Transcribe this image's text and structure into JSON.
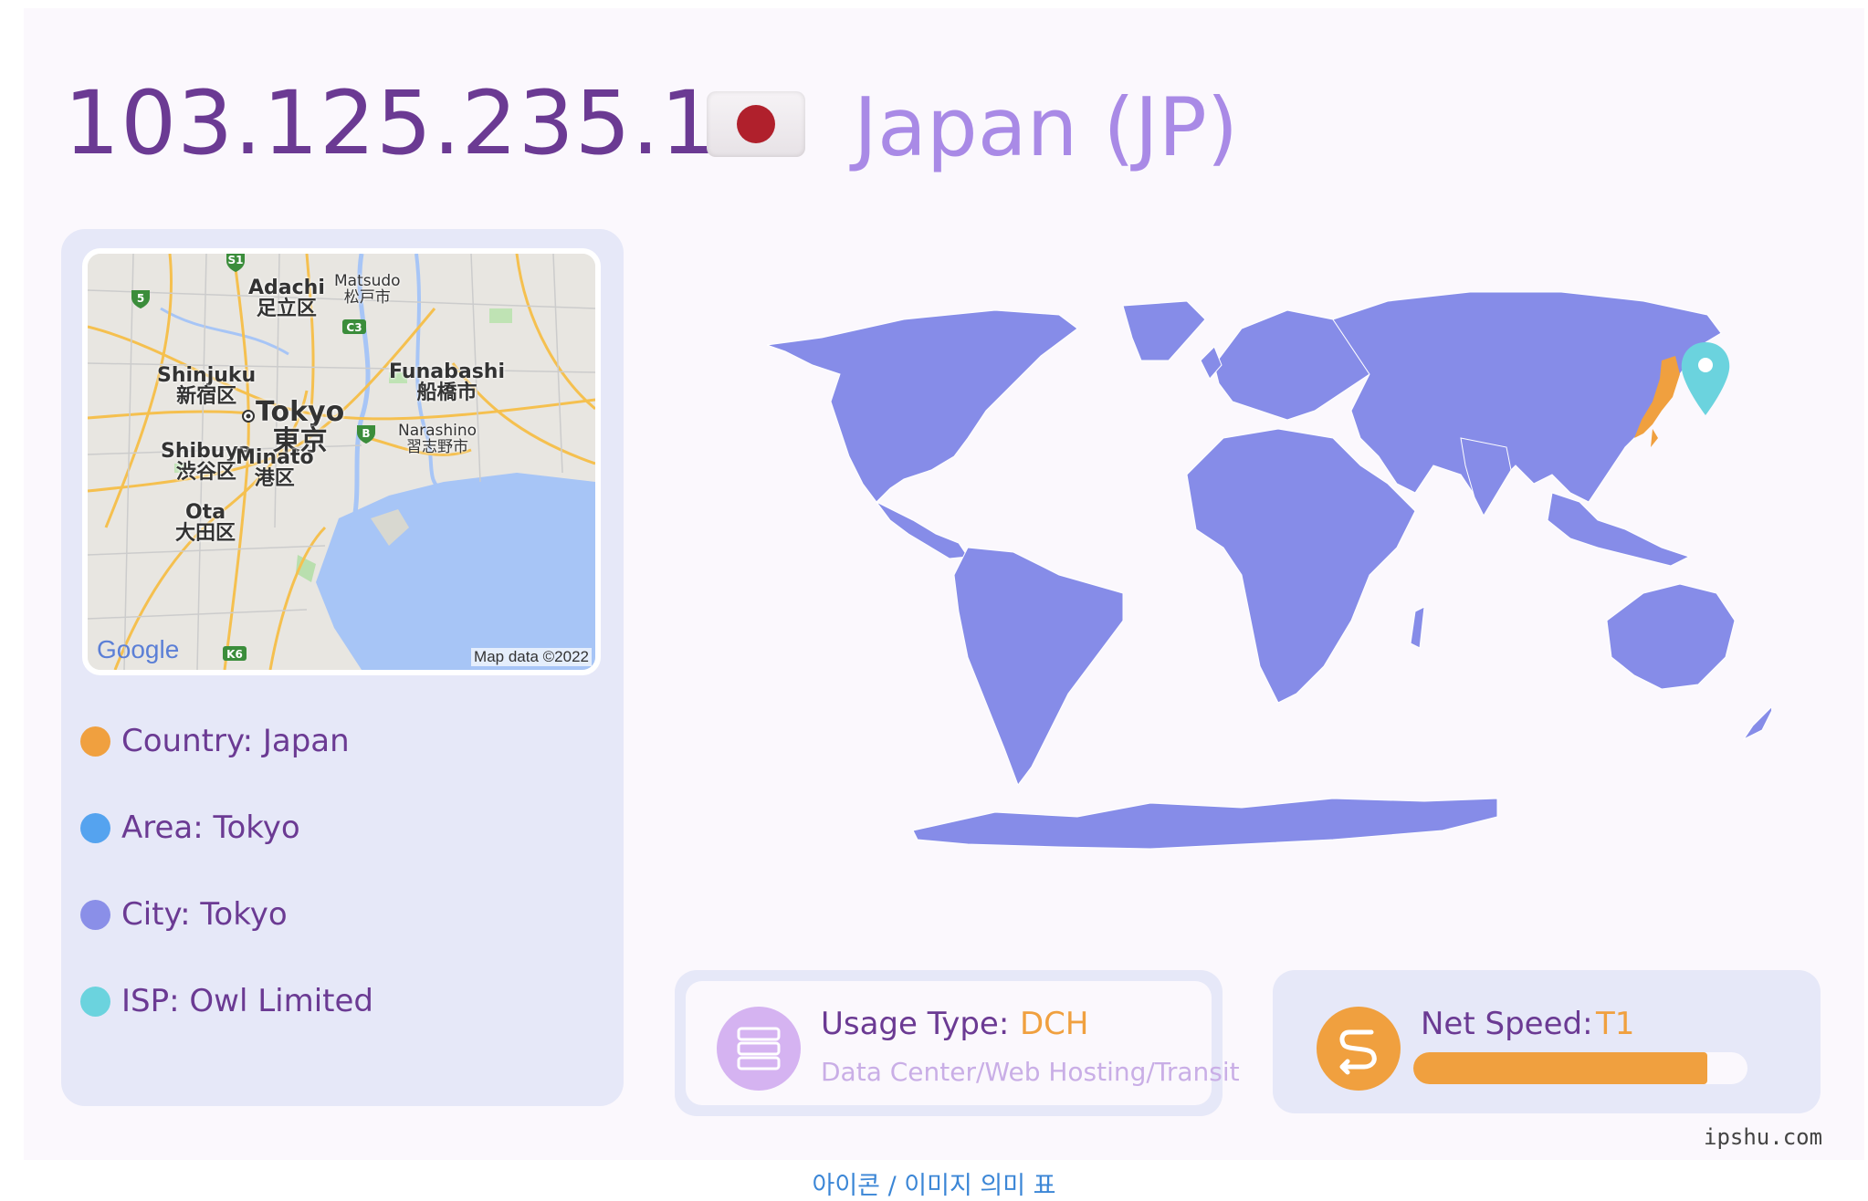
{
  "ip": "103.125.235.1",
  "country_title": "Japan (JP)",
  "map": {
    "labels": {
      "adachi_en": "Adachi",
      "adachi_jp": "足立区",
      "matsudo_en": "Matsudo",
      "matsudo_jp": "松戸市",
      "shinjuku_en": "Shinjuku",
      "shinjuku_jp": "新宿区",
      "tokyo_en": "Tokyo",
      "tokyo_jp": "東京",
      "funabashi_en": "Funabashi",
      "funabashi_jp": "船橋市",
      "narashino_en": "Narashino",
      "narashino_jp": "習志野市",
      "shibuya_en": "Shibuya",
      "shibuya_jp": "渋谷区",
      "minato_en": "Minato",
      "minato_jp": "港区",
      "ota_en": "Ota",
      "ota_jp": "大田区",
      "shield_s1": "S1",
      "shield_5": "5",
      "shield_c3": "C3",
      "shield_b": "B",
      "shield_k6": "K6"
    },
    "google": "Google",
    "attribution": "Map data ©2022"
  },
  "details": [
    {
      "text": "Country: Japan",
      "color": "#f0a03f"
    },
    {
      "text": "Area: Tokyo",
      "color": "#55a3ef"
    },
    {
      "text": "City: Tokyo",
      "color": "#8a8fe8"
    },
    {
      "text": "ISP: Owl Limited",
      "color": "#6bd3de"
    }
  ],
  "usage": {
    "label": "Usage Type:",
    "value": "DCH",
    "description": "Data Center/Web Hosting/Transit",
    "icon": "server-icon"
  },
  "speed": {
    "label": "Net Speed:",
    "value": "T1",
    "level": 0.88,
    "icon": "speed-route-icon"
  },
  "watermark": "ipshu.com",
  "footer_link": "아이콘 / 이미지 의미 표",
  "colors": {
    "ip": "#6b3a93",
    "country": "#a98ae6",
    "land": "#868ce8",
    "highlight": "#f0a03f",
    "pin": "#6bd3de",
    "usage_icon": "#d5b3f1",
    "speed_icon": "#f0a03f"
  }
}
